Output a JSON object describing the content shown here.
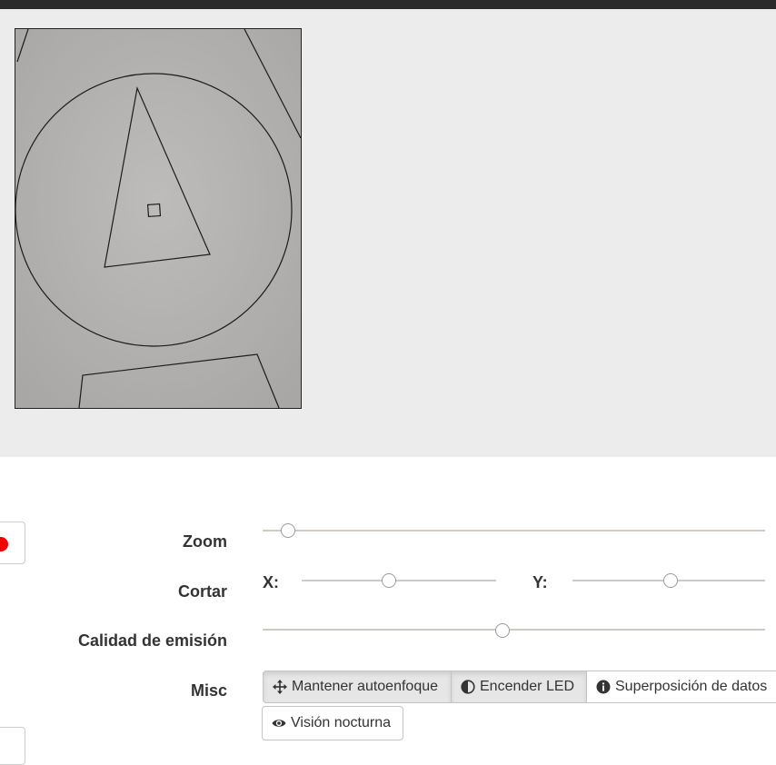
{
  "controls": {
    "zoom": {
      "label": "Zoom",
      "value": 0.05
    },
    "crop": {
      "label": "Cortar",
      "x_label": "X:",
      "y_label": "Y:",
      "x_value": 0.45,
      "y_value": 0.51
    },
    "quality": {
      "label": "Calidad de emisión",
      "value": 0.478
    },
    "misc": {
      "label": "Misc",
      "buttons": [
        {
          "label": "Mantener autoenfoque",
          "icon": "move-icon",
          "active": true
        },
        {
          "label": "Encender LED",
          "icon": "contrast-icon",
          "active": true
        },
        {
          "label": "Superposición de datos",
          "icon": "info-icon",
          "active": false
        },
        {
          "label": "Visión nocturna",
          "icon": "eye-icon",
          "active": false
        }
      ]
    }
  },
  "colors": {
    "record": "#ee0000",
    "preview_bg": "#ececec",
    "topbar": "#2b2b2b"
  }
}
